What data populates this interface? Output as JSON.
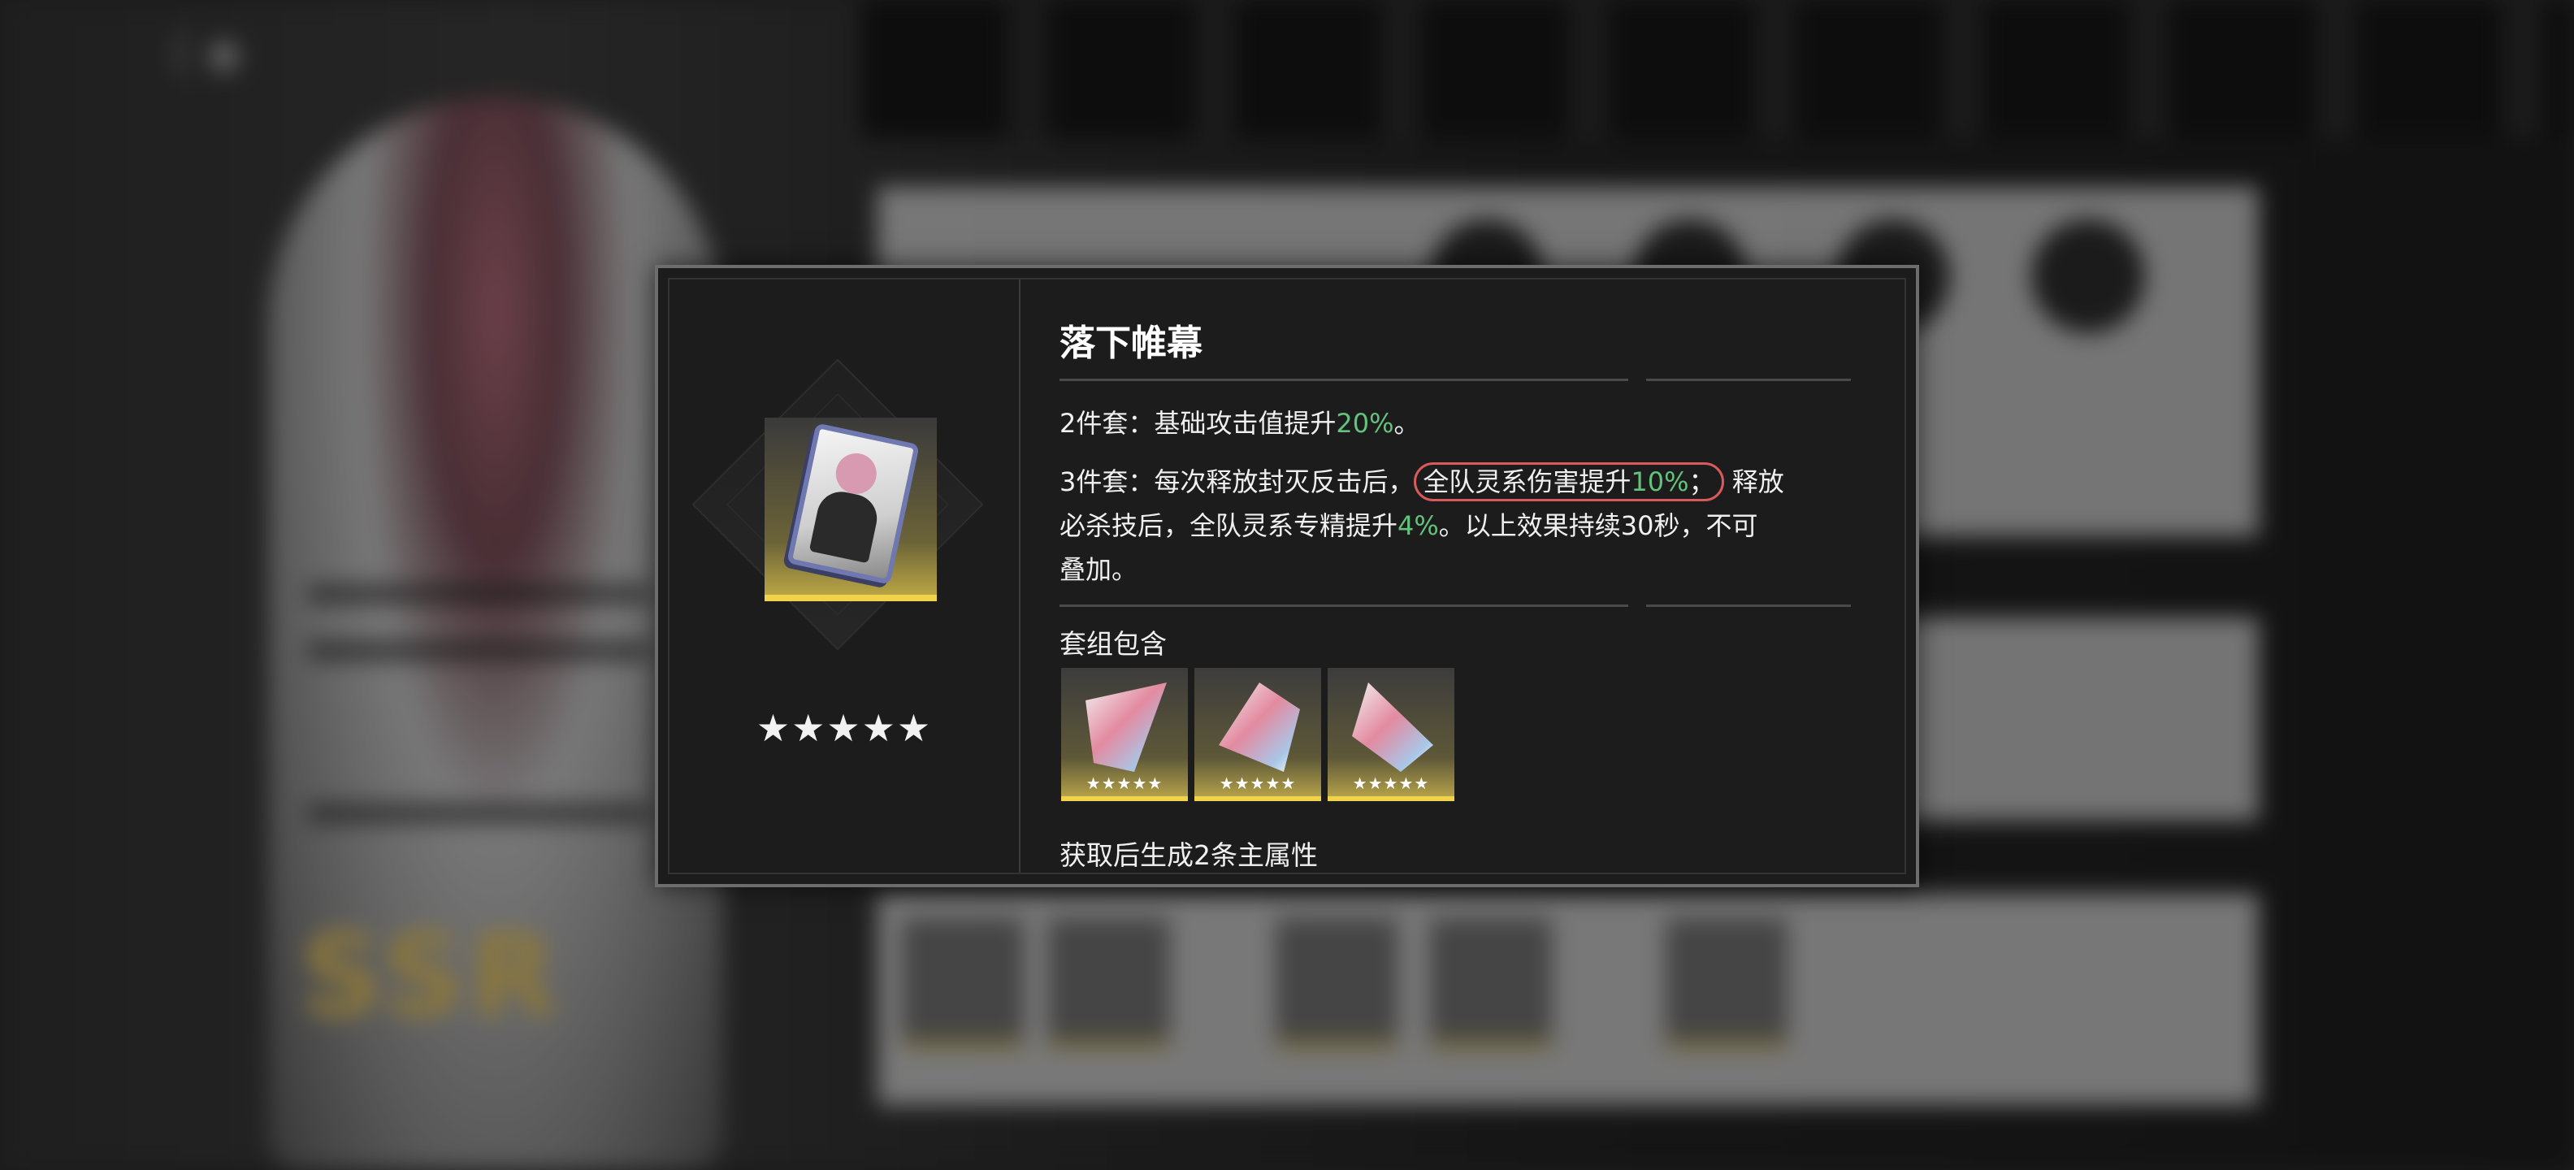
{
  "set": {
    "title": "落下帷幕",
    "rarity_stars": "★★★★★",
    "effect_2": {
      "prefix": "2件套：基础攻击值提升",
      "value": "20%",
      "suffix": "。"
    },
    "effect_3": {
      "prefix": "3件套：每次释放封灭反击后，",
      "highlight_text": "全队灵系伤害提升",
      "highlight_value": "10%",
      "highlight_suffix": "；",
      "rest_line1": "释放",
      "line2_prefix": "必杀技后，全队灵系专精提升",
      "line2_value": "4%",
      "line2_suffix": "。以上效果持续30秒，不可",
      "line3": "叠加。"
    },
    "pieces_label": "套组包含",
    "pieces": [
      {
        "name": "piece-1",
        "stars": "★★★★★"
      },
      {
        "name": "piece-2",
        "stars": "★★★★★"
      },
      {
        "name": "piece-3",
        "stars": "★★★★★"
      }
    ],
    "cutoff_text": "获取后生成2条主属性"
  },
  "background": {
    "rarity_badge": "SSR"
  },
  "colors": {
    "accent_green": "#63c27c",
    "highlight_circle": "#d95a5a",
    "gold": "#f0d34a"
  }
}
